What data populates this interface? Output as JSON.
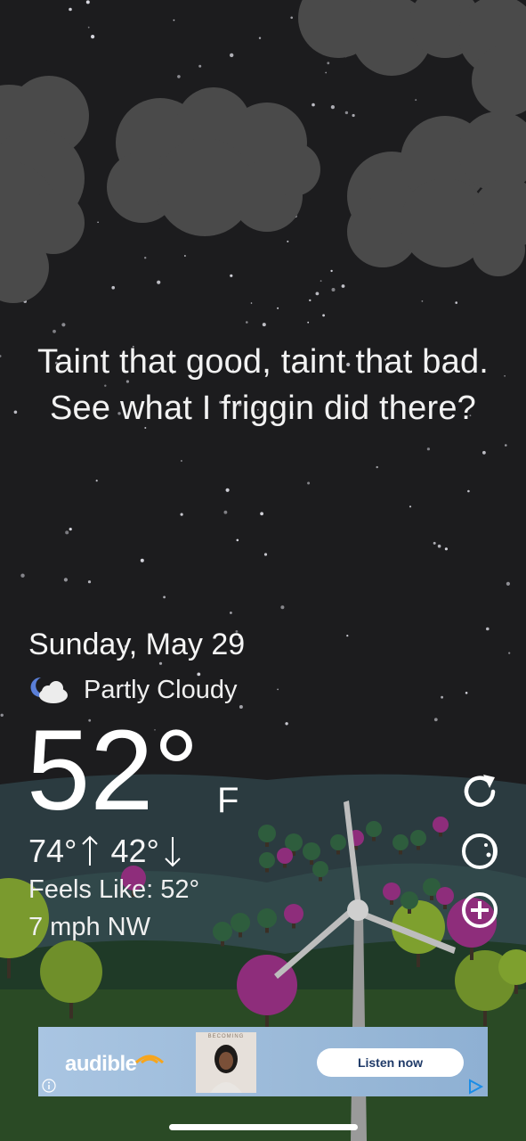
{
  "quote": "Taint that good, taint that bad. See what I friggin did there?",
  "weather": {
    "date": "Sunday, May 29",
    "condition": "Partly Cloudy",
    "condition_icon": "partly-cloudy-night-icon",
    "temperature": "52°",
    "unit": "F",
    "high": "74°",
    "low": "42°",
    "feels_like": "Feels Like: 52°",
    "wind": "7 mph NW"
  },
  "actions": {
    "refresh_icon": "refresh-icon",
    "moon_icon": "moon-phase-icon",
    "add_icon": "add-location-icon"
  },
  "ad": {
    "brand": "audible",
    "book_title": "BECOMING",
    "cta": "Listen now",
    "info_icon": "info-icon",
    "adchoices_icon": "adchoices-icon"
  },
  "colors": {
    "sky": "#1c1c1e",
    "cloud": "#474747",
    "ad_background": "#a9c5e2",
    "cta_text": "#1f3a68"
  }
}
